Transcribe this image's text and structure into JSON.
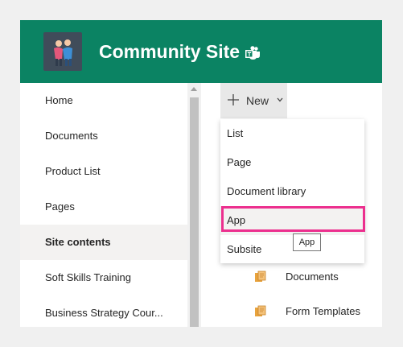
{
  "header": {
    "site_title": "Community Site",
    "logo_icon": "people-icon",
    "teams_icon": "teams-icon",
    "brand_color": "#0b8363"
  },
  "sidebar": {
    "items": [
      {
        "label": "Home"
      },
      {
        "label": "Documents"
      },
      {
        "label": "Product List"
      },
      {
        "label": "Pages"
      },
      {
        "label": "Site contents",
        "selected": true
      },
      {
        "label": "Soft Skills Training"
      },
      {
        "label": "Business Strategy Cour..."
      }
    ]
  },
  "toolbar": {
    "new_label": "New",
    "new_icon": "plus-icon",
    "chevron_icon": "chevron-down-icon"
  },
  "new_menu": {
    "items": [
      {
        "label": "List"
      },
      {
        "label": "Page"
      },
      {
        "label": "Document library"
      },
      {
        "label": "App",
        "highlighted": true
      },
      {
        "label": "Subsite"
      }
    ],
    "highlight_color": "#ec2f8e"
  },
  "tooltip": {
    "text": "App"
  },
  "contents": {
    "rows": [
      {
        "label": "Documents",
        "icon": "document-library-icon"
      },
      {
        "label": "Form Templates",
        "icon": "document-library-icon"
      }
    ]
  }
}
